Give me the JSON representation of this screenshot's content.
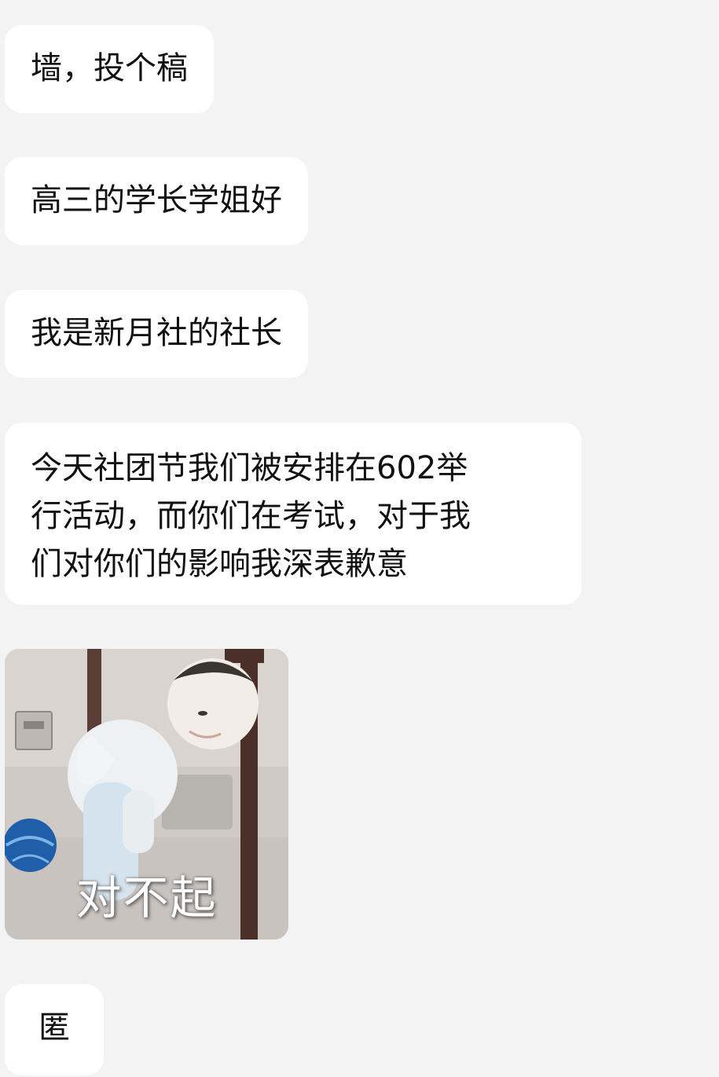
{
  "messages": [
    {
      "text": "墙，投个稿"
    },
    {
      "text": "高三的学长学姐好"
    },
    {
      "text": "我是新月社的社长"
    },
    {
      "lines": [
        "今天社团节我们被安排在602举",
        "行活动，而你们在考试，对于我",
        "们对你们的影响我深表歉意"
      ]
    },
    {
      "sticker": {
        "caption": "对不起",
        "icon": "sorry-baby-sticker"
      }
    },
    {
      "text": "匿"
    }
  ],
  "colors": {
    "background": "#f3f3f3",
    "bubble": "#ffffff",
    "text": "#111111"
  }
}
